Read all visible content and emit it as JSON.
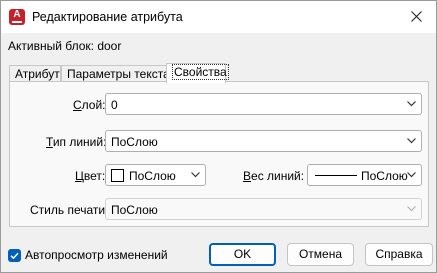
{
  "window": {
    "title": "Редактирование атрибута",
    "icon": "autocad-app-icon",
    "icon_glyph": "A"
  },
  "active_block": "Активный блок: door",
  "tabs": [
    {
      "label": "Атрибут",
      "active": false
    },
    {
      "label": "Параметры текста",
      "active": false
    },
    {
      "label": "Свойства",
      "active": true
    }
  ],
  "properties": {
    "layer": {
      "label_prefix": "",
      "label_underline": "С",
      "label_rest": "лой:",
      "value": "0"
    },
    "linetype": {
      "label_prefix": "",
      "label_underline": "Т",
      "label_rest": "ип линий:",
      "value": "ПоСлою"
    },
    "color": {
      "label_prefix": "",
      "label_underline": "Ц",
      "label_rest": "вет:",
      "value": "ПоСлою",
      "swatch_color": "#ffffff"
    },
    "lineweight": {
      "label_prefix": "",
      "label_underline": "В",
      "label_rest": "ес линий:",
      "value": "ПоСлою"
    },
    "plotstyle": {
      "label": "Стиль печати:",
      "value": "ПоСлою",
      "enabled": false
    }
  },
  "footer": {
    "auto_preview_label": "Автопросмотр изменений",
    "auto_preview_checked": true,
    "ok_label": "OK",
    "cancel_label": "Отмена",
    "help_label": "Справка"
  },
  "colors": {
    "accent": "#005fb8",
    "app_icon": "#c8202b"
  }
}
